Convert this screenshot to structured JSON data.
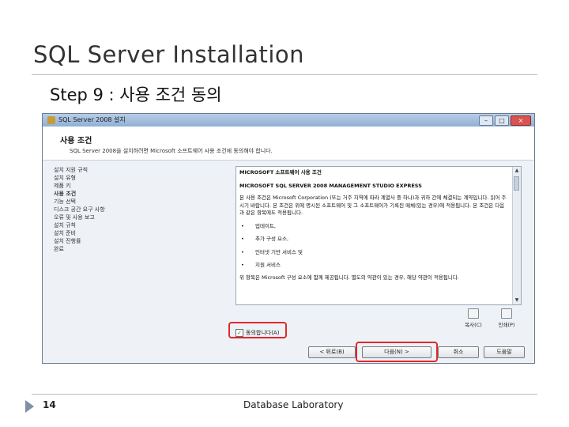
{
  "slide": {
    "title": "SQL Server Installation",
    "bullet_glyph": "",
    "step": "Step 9 : 사용 조건 동의",
    "page_number": "14",
    "footer": "Database Laboratory"
  },
  "window": {
    "title": "SQL Server 2008 설치",
    "controls": {
      "minimize": "–",
      "maximize": "□",
      "close": "×"
    },
    "header_title": "사용 조건",
    "header_desc": "SQL Server 2008을 설치하려면 Microsoft 소프트웨어 사용 조건에 동의해야 합니다.",
    "nav_items": [
      "설치 지원 규칙",
      "설치 유형",
      "제품 키",
      "사용 조건",
      "기능 선택",
      "디스크 공간 요구 사항",
      "오류 및 사용 보고",
      "설치 규칙",
      "설치 준비",
      "설치 진행률",
      "완료"
    ],
    "license": {
      "heading1": "MICROSOFT 소프트웨어 사용 조건",
      "heading2": "MICROSOFT SQL SERVER 2008 MANAGEMENT STUDIO EXPRESS",
      "paragraph": "본 사용 조건은 Microsoft Corporation (또는 거주 지역에 따라 계열사 중 하나)과 귀하 간에 체결되는 계약입니다. 읽어 주시기 바랍니다. 본 조건은 위에 명시된 소프트웨어 및 그 소프트웨어가 기록된 매체(있는 경우)에 적용됩니다. 본 조건은 다음과 같은 항목에도 적용됩니다.",
      "items": [
        "업데이트,",
        "추가 구성 요소,",
        "인터넷 기반 서비스 및",
        "지원 서비스"
      ],
      "footer_text": "위 항목은 Microsoft 구성 요소에 함께 제공됩니다. 별도의 약관이 있는 경우, 해당 약관이 적용됩니다."
    },
    "side_buttons": {
      "copy": "복사(C)",
      "print": "인쇄(P)"
    },
    "agree_check": "✓",
    "agree_label": "동의합니다(A)",
    "buttons": {
      "back": "< 뒤로(B)",
      "next": "다음(N) >",
      "cancel": "취소",
      "help": "도움말"
    }
  }
}
